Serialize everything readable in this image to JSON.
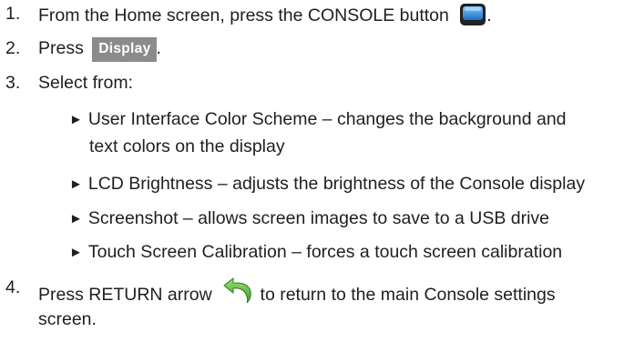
{
  "steps": [
    {
      "num": "1.",
      "text_before": "From the Home screen, press the CONSOLE button",
      "icon": "console-button-icon",
      "text_after": "."
    },
    {
      "num": "2.",
      "text_before": "Press",
      "button_label": "Display",
      "text_after": "."
    },
    {
      "num": "3.",
      "text": "Select from:",
      "options": [
        {
          "line1": "User Interface Color Scheme – changes the background and",
          "line2": "text colors on the display"
        },
        {
          "line1": "LCD Brightness – adjusts the brightness of the Console display"
        },
        {
          "line1": "Screenshot – allows screen images to save to a USB drive"
        },
        {
          "line1": "Touch Screen Calibration – forces a touch screen calibration"
        }
      ]
    },
    {
      "num": "4.",
      "text_before": "Press RETURN arrow",
      "icon": "return-arrow-icon",
      "text_after": "to return to the main Console settings",
      "line2": "screen."
    }
  ],
  "bullet_glyph": "►",
  "colors": {
    "text": "#1f1f1f",
    "display_button_bg": "#8b8b8b",
    "console_icon_blue": "#2f8fe0",
    "return_arrow_green": "#4aa82f"
  }
}
